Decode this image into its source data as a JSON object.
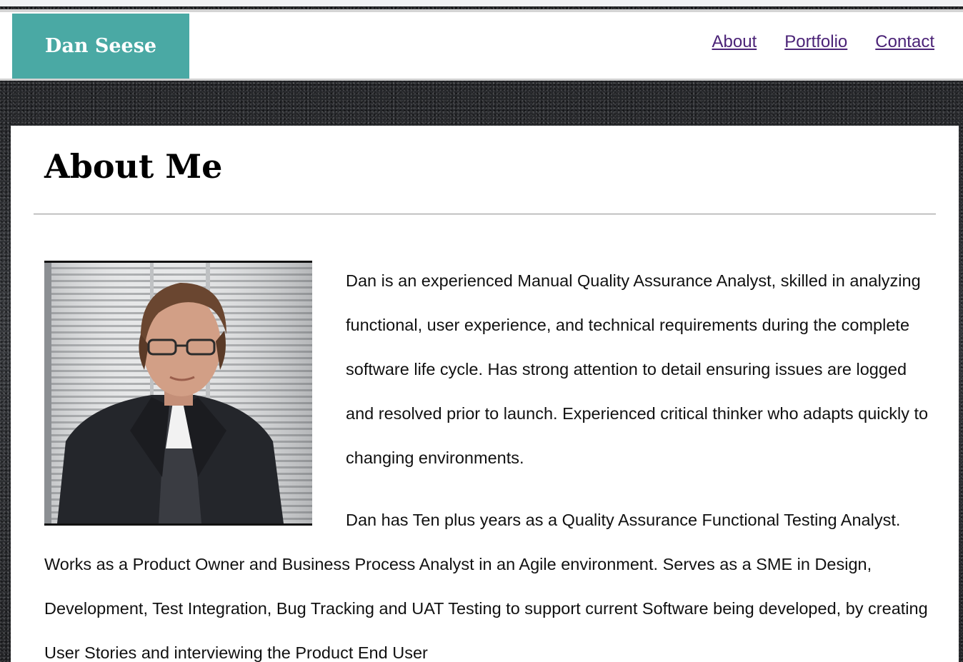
{
  "header": {
    "brand": "Dan Seese",
    "nav": [
      {
        "label": "About"
      },
      {
        "label": "Portfolio"
      },
      {
        "label": "Contact"
      }
    ]
  },
  "main": {
    "title": "About Me",
    "paragraphs": [
      "Dan is an experienced Manual Quality Assurance Analyst, skilled in analyzing functional, user experience, and technical requirements during the complete software life cycle. Has strong attention to detail ensuring issues are logged and resolved prior to launch. Experienced critical thinker who adapts quickly to changing environments.",
      "Dan has Ten plus years as a Quality Assurance Functional Testing Analyst. Works as a Product Owner and Business Process Analyst in an Agile environment. Serves as a SME in Design, Development, Test Integration, Bug Tracking and UAT Testing to support current Software being developed, by creating User Stories and interviewing the Product End User"
    ]
  },
  "colors": {
    "brand_bg": "#4aa9a4",
    "link": "#4b2377"
  }
}
